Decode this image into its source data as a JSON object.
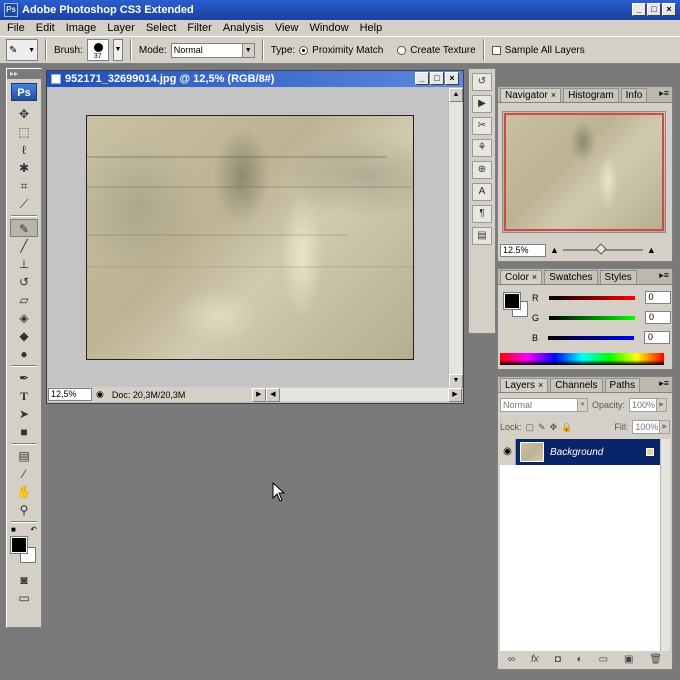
{
  "app": {
    "title": "Adobe Photoshop CS3 Extended",
    "ps_badge": "Ps",
    "window_buttons": [
      "_",
      "□",
      "×"
    ]
  },
  "menu": [
    "File",
    "Edit",
    "Image",
    "Layer",
    "Select",
    "Filter",
    "Analysis",
    "View",
    "Window",
    "Help"
  ],
  "options": {
    "brush_label": "Brush:",
    "brush_size": "37",
    "mode_label": "Mode:",
    "mode_value": "Normal",
    "type_label": "Type:",
    "radio_proximity": "Proximity Match",
    "radio_texture": "Create Texture",
    "sample_all_layers": "Sample All Layers"
  },
  "toolbox": {
    "logo": "Ps",
    "tools": [
      "move-tool-icon",
      "marquee-tool-icon",
      "lasso-tool-icon",
      "magic-wand-icon",
      "crop-tool-icon",
      "slice-tool-icon",
      "spot-healing-brush-icon",
      "brush-tool-icon",
      "clone-stamp-icon",
      "history-brush-icon",
      "eraser-tool-icon",
      "paint-bucket-icon",
      "blur-tool-icon",
      "dodge-tool-icon",
      "pen-tool-icon",
      "type-tool-icon",
      "path-selection-icon",
      "shape-tool-icon",
      "notes-tool-icon",
      "eyedropper-icon",
      "hand-tool-icon",
      "zoom-tool-icon"
    ]
  },
  "document": {
    "title": "952171_32699014.jpg @ 12,5% (RGB/8#)",
    "zoom": "12,5%",
    "doc_info": "Doc: 20,3M/20,3M"
  },
  "navigator": {
    "tabs": [
      "Navigator",
      "Histogram",
      "Info"
    ],
    "zoom": "12.5%"
  },
  "color": {
    "tabs": [
      "Color",
      "Swatches",
      "Styles"
    ],
    "channels": [
      {
        "label": "R",
        "value": "0",
        "color": "#d00000"
      },
      {
        "label": "G",
        "value": "0",
        "color": "#00b000"
      },
      {
        "label": "B",
        "value": "0",
        "color": "#0000d0"
      }
    ],
    "foreground": "#000000",
    "background": "#ffffff"
  },
  "layers": {
    "tabs": [
      "Layers",
      "Channels",
      "Paths"
    ],
    "blend_mode": "Normal",
    "opacity_label": "Opacity:",
    "opacity_value": "100%",
    "lock_label": "Lock:",
    "fill_label": "Fill:",
    "fill_value": "100%",
    "items": [
      {
        "name": "Background"
      }
    ],
    "footer_icons": [
      "link-layers-icon",
      "fx-icon",
      "mask-icon",
      "adjustment-icon",
      "group-icon",
      "new-layer-icon",
      "trash-icon"
    ]
  }
}
